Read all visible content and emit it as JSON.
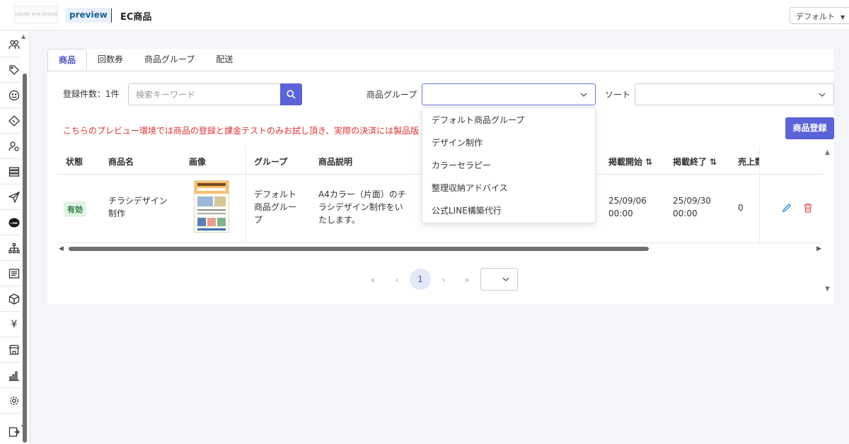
{
  "header": {
    "logo_text": "KAZUMI SIYA DESIGN",
    "env_badge": "preview",
    "page_title": "EC商品",
    "profile_select": "デフォルト"
  },
  "sidebar": {
    "items": [
      {
        "icon": "users-icon"
      },
      {
        "icon": "tag-icon"
      },
      {
        "icon": "smile-icon"
      },
      {
        "icon": "ticket-icon"
      },
      {
        "icon": "user-settings-icon"
      },
      {
        "icon": "list-icon"
      },
      {
        "icon": "send-icon"
      },
      {
        "icon": "line-icon",
        "label": "LINE"
      },
      {
        "icon": "sitemap-icon"
      },
      {
        "icon": "document-icon"
      },
      {
        "icon": "box-icon"
      },
      {
        "icon": "yen-icon",
        "label": "¥"
      },
      {
        "icon": "store-icon"
      },
      {
        "icon": "bar-chart-icon"
      },
      {
        "icon": "gear-icon"
      },
      {
        "icon": "export-icon"
      }
    ]
  },
  "tabs": [
    {
      "label": "商品",
      "active": true
    },
    {
      "label": "回数券",
      "active": false
    },
    {
      "label": "商品グループ",
      "active": false
    },
    {
      "label": "配送",
      "active": false
    }
  ],
  "filters": {
    "count_text": "登録件数：1件",
    "keyword_placeholder": "検索キーワード",
    "group_label": "商品グループ",
    "group_value": "",
    "sort_label": "ソート",
    "sort_value": ""
  },
  "notice": "こちらのプレビュー環境では商品の登録と課金テストのみお試し頂き、実際の決済には製品版",
  "register_button": "商品登録",
  "table": {
    "headers": {
      "status": "状態",
      "name": "商品名",
      "image": "画像",
      "group": "グループ",
      "description": "商品説明",
      "start": "掲載開始 ⇅",
      "end": "掲載終了 ⇅",
      "sales": "売上数"
    },
    "rows": [
      {
        "status": "有効",
        "name_l1": "チラシデザイン",
        "name_l2": "制作",
        "group_l1": "デフォルト",
        "group_l2": "商品グルー",
        "group_l3": "プ",
        "desc_l1": "A4カラー（片面）のチ",
        "desc_l2": "ラシデザイン制作をい",
        "desc_l3": "たします。",
        "start_l1": "25/09/06",
        "start_l2": "00:00",
        "end_l1": "25/09/30",
        "end_l2": "00:00",
        "sales": "0"
      }
    ]
  },
  "pagination": {
    "first": "«",
    "prev": "‹",
    "current": "1",
    "next": "›",
    "last": "»",
    "page_size": ""
  },
  "group_dropdown": {
    "options": [
      "デフォルト商品グループ",
      "デザイン制作",
      "カラーセラピー",
      "整理収納アドバイス",
      "公式LINE構築代行"
    ]
  },
  "colors": {
    "accent": "#5a63d8",
    "notice": "#dd3333",
    "badge_bg": "#e2f4e6",
    "delete": "#e05a5a",
    "edit": "#2a8fd8"
  }
}
